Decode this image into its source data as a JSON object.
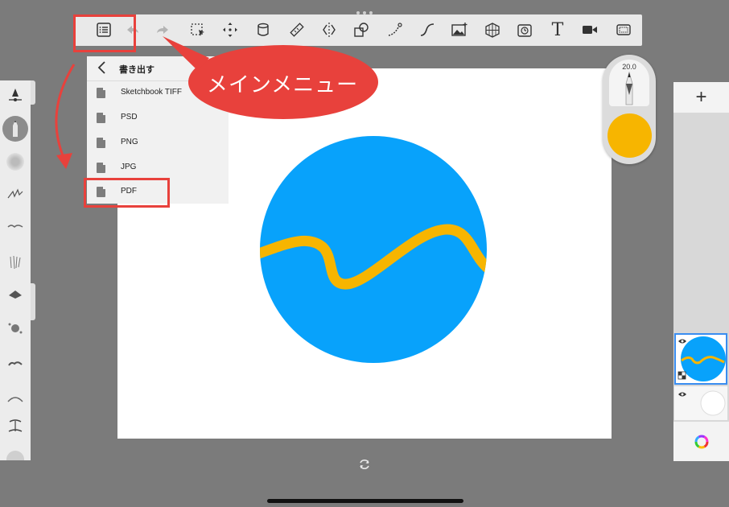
{
  "toolbar": {
    "buttons": [
      {
        "name": "main-menu-button",
        "icon": "list-icon"
      },
      {
        "name": "undo-button",
        "icon": "undo-icon"
      },
      {
        "name": "redo-button",
        "icon": "redo-icon"
      },
      {
        "name": "selection-tool-button",
        "icon": "selection-icon"
      },
      {
        "name": "transform-tool-button",
        "icon": "move-icon"
      },
      {
        "name": "fill-tool-button",
        "icon": "bucket-icon"
      },
      {
        "name": "ruler-tool-button",
        "icon": "ruler-icon"
      },
      {
        "name": "symmetry-tool-button",
        "icon": "symmetry-icon"
      },
      {
        "name": "shape-tool-button",
        "icon": "shape-icon"
      },
      {
        "name": "stroke-tool-button",
        "icon": "stroke-icon"
      },
      {
        "name": "curve-tool-button",
        "icon": "curve-icon"
      },
      {
        "name": "image-import-button",
        "icon": "image-icon"
      },
      {
        "name": "perspective-tool-button",
        "icon": "perspective-icon"
      },
      {
        "name": "timelapse-button",
        "icon": "timelapse-icon"
      },
      {
        "name": "text-tool-button",
        "icon": "text-icon"
      },
      {
        "name": "record-button",
        "icon": "video-icon"
      },
      {
        "name": "fullscreen-button",
        "icon": "fullscreen-icon"
      }
    ],
    "text_tool_glyph": "T"
  },
  "menu": {
    "title": "書き出す",
    "items": [
      {
        "label": "Sketchbook TIFF"
      },
      {
        "label": "PSD"
      },
      {
        "label": "PNG"
      },
      {
        "label": "JPG"
      },
      {
        "label": "PDF"
      }
    ]
  },
  "callout": {
    "text": "メインメニュー",
    "color": "#e8413c"
  },
  "puck": {
    "brush_size": "20.0",
    "color": "#f7b500"
  },
  "layers": {
    "add_label": "+"
  },
  "artwork": {
    "circle_color": "#08a2fb",
    "wave_color": "#f7b500"
  },
  "colors": {
    "highlight": "#e8413c",
    "selected_layer_border": "#3a8df0"
  }
}
